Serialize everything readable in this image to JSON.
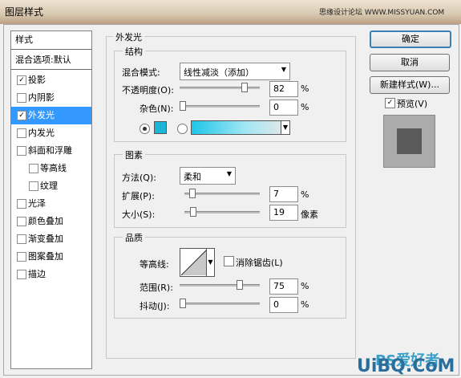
{
  "window": {
    "title": "图层样式",
    "watermark_top": "思缘设计论坛 WWW.MISSYUAN.COM",
    "watermark_bottom": "UiBQ.CoM",
    "watermark_ps": "PS爱好者"
  },
  "sidebar": {
    "header": "样式",
    "blend_default": "混合选项:默认",
    "items": [
      {
        "label": "投影",
        "checked": true
      },
      {
        "label": "内阴影",
        "checked": false
      },
      {
        "label": "外发光",
        "checked": true,
        "selected": true
      },
      {
        "label": "内发光",
        "checked": false
      },
      {
        "label": "斜面和浮雕",
        "checked": false
      },
      {
        "label": "等高线",
        "checked": false,
        "sub": true
      },
      {
        "label": "纹理",
        "checked": false,
        "sub": true
      },
      {
        "label": "光泽",
        "checked": false
      },
      {
        "label": "颜色叠加",
        "checked": false
      },
      {
        "label": "渐变叠加",
        "checked": false
      },
      {
        "label": "图案叠加",
        "checked": false
      },
      {
        "label": "描边",
        "checked": false
      }
    ]
  },
  "panel": {
    "title": "外发光",
    "structure": {
      "title": "结构",
      "blend_mode_label": "混合模式:",
      "blend_mode_value": "线性减淡（添加）",
      "opacity_label": "不透明度(O):",
      "opacity_value": "82",
      "noise_label": "杂色(N):",
      "noise_value": "0",
      "unit": "%",
      "color": "#1eb6d8"
    },
    "elements": {
      "title": "图素",
      "method_label": "方法(Q):",
      "method_value": "柔和",
      "spread_label": "扩展(P):",
      "spread_value": "7",
      "size_label": "大小(S):",
      "size_value": "19",
      "size_unit": "像素",
      "unit": "%"
    },
    "quality": {
      "title": "品质",
      "contour_label": "等高线:",
      "antialias_label": "消除锯齿(L)",
      "antialias_checked": false,
      "range_label": "范围(R):",
      "range_value": "75",
      "jitter_label": "抖动(J):",
      "jitter_value": "0",
      "unit": "%"
    }
  },
  "buttons": {
    "ok": "确定",
    "cancel": "取消",
    "new_style": "新建样式(W)...",
    "preview": "预览(V)",
    "preview_checked": true
  },
  "levels": {
    "opacity": 0.82,
    "noise": 0.0,
    "spread": 0.07,
    "size": 0.08,
    "range": 0.75,
    "jitter": 0.0
  }
}
